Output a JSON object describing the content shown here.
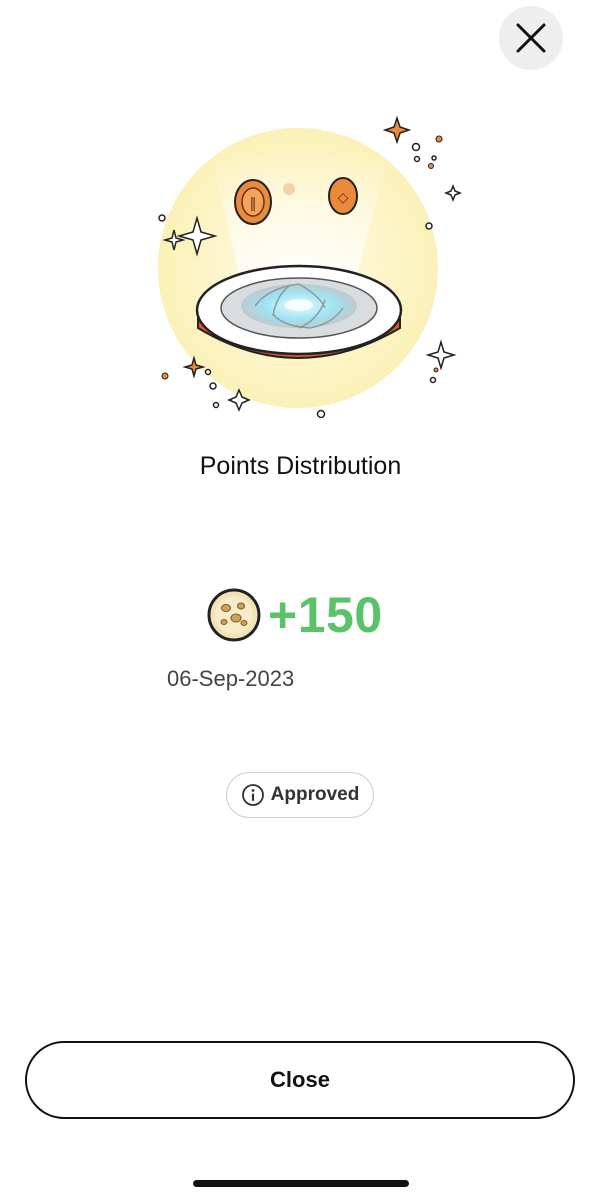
{
  "header": {
    "close_icon": "close-x-icon"
  },
  "illustration": {
    "icon": "points-portal-illustration",
    "colors": {
      "glow": "#fbf1b8",
      "disc_edge": "#e2572b",
      "coin": "#e98a3c"
    }
  },
  "title": "Points Distribution",
  "points": {
    "value": "+150",
    "icon": "cookie-coin-icon",
    "color": "#5cc26a"
  },
  "date": "06-Sep-2023",
  "status": {
    "label": "Approved",
    "icon": "info-icon"
  },
  "footer": {
    "close_label": "Close"
  }
}
